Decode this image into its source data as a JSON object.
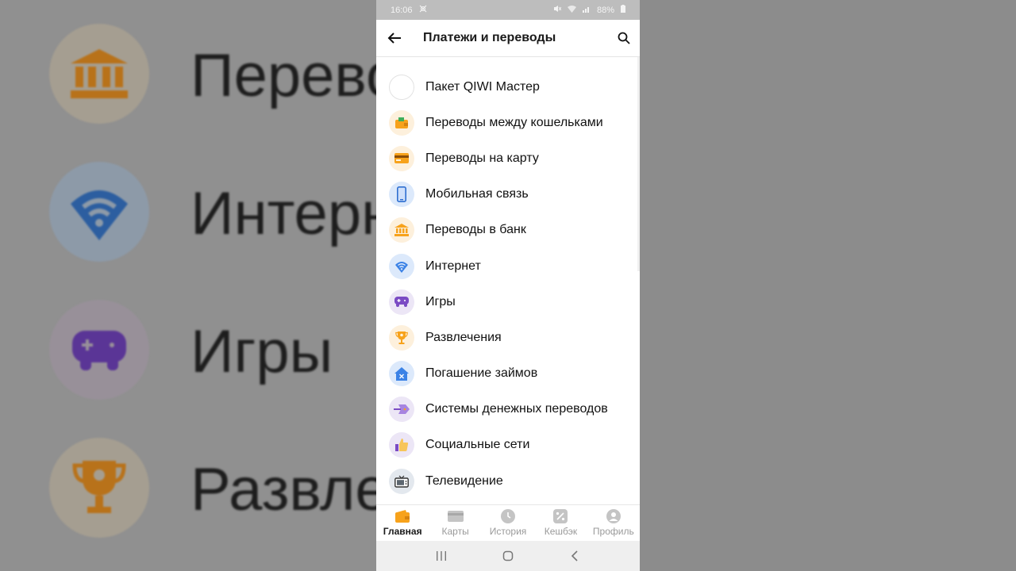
{
  "background": {
    "left_rows": [
      {
        "text": "Переводы",
        "icon": "bank-icon"
      },
      {
        "text": "Интернет",
        "icon": "wifi-icon"
      },
      {
        "text": "Игры",
        "icon": "gamepad-icon"
      },
      {
        "text": "Развлечения",
        "icon": "trophy-icon"
      }
    ]
  },
  "status_bar": {
    "time": "16:06",
    "battery": "88%"
  },
  "header": {
    "title": "Платежи и переводы"
  },
  "list": {
    "items": [
      {
        "label": "Пакет QIWI Мастер",
        "icon": "empty-icon"
      },
      {
        "label": "Переводы между кошельками",
        "icon": "wallet-icon"
      },
      {
        "label": "Переводы на карту",
        "icon": "card-icon"
      },
      {
        "label": "Мобильная связь",
        "icon": "phone-icon"
      },
      {
        "label": "Переводы в банк",
        "icon": "bank-icon"
      },
      {
        "label": "Интернет",
        "icon": "wifi-icon"
      },
      {
        "label": "Игры",
        "icon": "gamepad-icon"
      },
      {
        "label": "Развлечения",
        "icon": "trophy-icon"
      },
      {
        "label": "Погашение займов",
        "icon": "house-icon"
      },
      {
        "label": "Системы денежных переводов",
        "icon": "transfer-icon"
      },
      {
        "label": "Социальные сети",
        "icon": "thumbs-up-icon"
      },
      {
        "label": "Телевидение",
        "icon": "tv-icon"
      }
    ]
  },
  "tabs": [
    {
      "label": "Главная",
      "active": true
    },
    {
      "label": "Карты",
      "active": false
    },
    {
      "label": "История",
      "active": false
    },
    {
      "label": "Кешбэк",
      "active": false
    },
    {
      "label": "Профиль",
      "active": false
    }
  ],
  "colors": {
    "accent": "#f7a21b",
    "blue": "#3b82e6",
    "purple": "#7b4bc4"
  }
}
